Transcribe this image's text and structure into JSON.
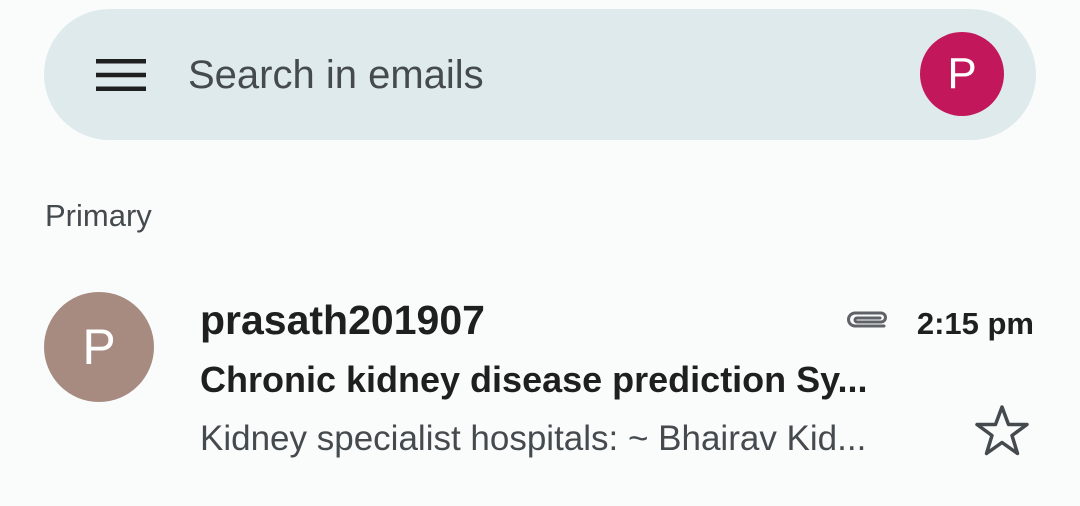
{
  "search": {
    "placeholder": "Search in emails"
  },
  "account": {
    "avatar_letter": "P",
    "avatar_color": "#c2185b"
  },
  "icons": {
    "menu": "hamburger-menu-icon",
    "attachment": "paperclip-icon",
    "star": "star-outline-icon"
  },
  "section": {
    "label": "Primary"
  },
  "emails": [
    {
      "avatar_letter": "P",
      "avatar_color": "#a78b80",
      "sender": "prasath201907",
      "time": "2:15 pm",
      "has_attachment": true,
      "subject": "Chronic kidney disease prediction Sy...",
      "snippet": "Kidney specialist hospitals: ~ Bhairav Kid...",
      "starred": false
    }
  ]
}
